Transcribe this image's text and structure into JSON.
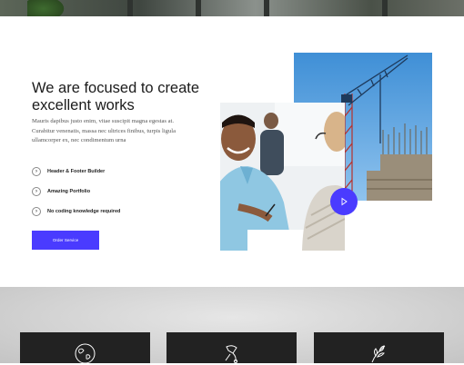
{
  "hero": {
    "heading": "We are focused to create excellent works",
    "description": "Mauris dapibus justo enim, vitae suscipit magna egestas at. Curabitur venenatis, massa nec ultrices finibus, turpis ligula ullamcorper ex, nec condimentum urna",
    "features": [
      {
        "label": "Header & Footer Builder",
        "icon": "chevron-right-icon"
      },
      {
        "label": "Amazing Portfolio",
        "icon": "chevron-right-icon"
      },
      {
        "label": "No coding knowledge required",
        "icon": "chevron-right-icon"
      }
    ],
    "cta_label": "Order Service"
  },
  "media": {
    "crane_image": "construction-crane-image",
    "people_image": "business-meeting-image",
    "play_icon": "play-icon"
  },
  "services": {
    "cards": [
      {
        "icon": "globe-icon"
      },
      {
        "icon": "rocket-icon"
      },
      {
        "icon": "leaf-icon"
      }
    ]
  },
  "colors": {
    "accent": "#4a3bff",
    "heading": "#1b1b1b",
    "card_bg": "#222222"
  }
}
